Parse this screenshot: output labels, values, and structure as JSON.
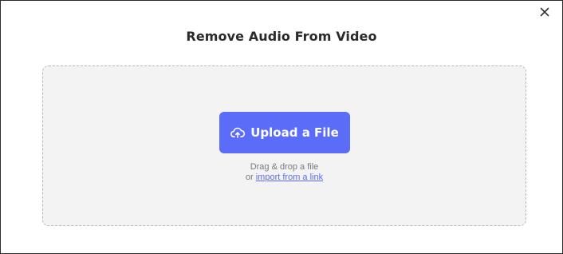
{
  "dialog": {
    "title": "Remove Audio From Video",
    "close_icon": "close-icon"
  },
  "dropzone": {
    "upload_button_label": "Upload a File",
    "upload_icon": "cloud-upload-icon",
    "drag_text": "Drag & drop a file",
    "or_text": "or",
    "import_link_label": "import from a link"
  },
  "colors": {
    "accent": "#5b6cf9",
    "dropzone_bg": "#f3f3f3",
    "title": "#2a2a2a",
    "hint": "#7a7a7a"
  }
}
